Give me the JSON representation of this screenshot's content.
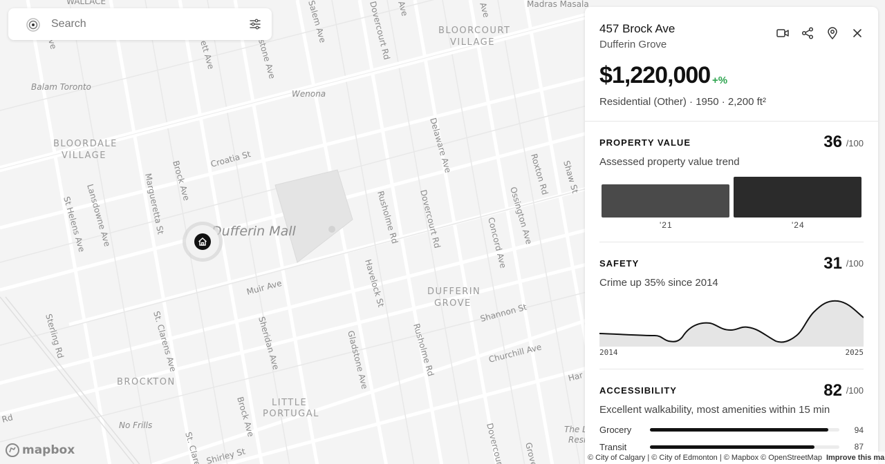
{
  "map": {
    "labels": {
      "wallace": "WALLACE",
      "madras": "Madras Masala",
      "balam": "Balam Toronto",
      "wenona": "Wenona",
      "bloorcourt1": "BLOORCOURT",
      "bloorcourt2": "VILLAGE",
      "bloordale1": "BLOORDALE",
      "bloordale2": "VILLAGE",
      "dufferin_mall": "Dufferin Mall",
      "dufferin_grove1": "DUFFERIN",
      "dufferin_grove2": "GROVE",
      "brockton": "BROCKTON",
      "little_portugal1": "LITTLE",
      "little_portugal2": "PORTUGAL",
      "no_frills": "No Frills",
      "croatia": "Croatia St",
      "brock": "Brock Ave",
      "brock2": "Brock Ave",
      "margueretta": "Margueretta St",
      "lansdowne": "Lansdowne Ave",
      "st_helens": "St Helens Ave",
      "muir": "Muir Ave",
      "st_clarens": "St. Clarens Ave",
      "st_clarens2": "St. Clare",
      "sheridan": "Sheridan Ave",
      "gladstone": "Gladstone Ave",
      "havelock": "Havelock St",
      "rusholme": "Rusholme Rd",
      "rusholme2": "Rusholme Rd",
      "dovercourt": "Dovercourt Rd",
      "dovercourt2": "Dovercourt Rd",
      "dovercourt3": "Dovercourt",
      "delaware": "Delaware Ave",
      "concord": "Concord Ave",
      "ossington": "Ossington Ave",
      "roxton": "Roxton Rd",
      "shaw": "Shaw St",
      "shannon": "Shannon St",
      "churchill": "Churchill Ave",
      "sterling": "Sterling Rd",
      "salem": "Salem Ave",
      "gladstone_top": "stone Ave",
      "ett": "ett Ave",
      "shirley": "Shirley St",
      "rd_left": "Rd",
      "the_res1": "The L",
      "the_res2": "Resi",
      "har": "Har",
      "grove": "Grove",
      "ave_top": "Ave",
      "ave_top2": "Ave",
      "ve_left": "ve"
    }
  },
  "search": {
    "placeholder": "Search",
    "logo_icon": "target-logo-icon",
    "filter_icon": "sliders-icon"
  },
  "property": {
    "address": "457 Brock Ave",
    "neighbourhood": "Dufferin Grove",
    "price": "$1,220,000",
    "change": "+%",
    "details": "Residential (Other) · 1950 · 2,200 ft²",
    "change_color": "#2ea44f",
    "actions": [
      "video-icon",
      "share-icon",
      "map-pin-icon",
      "close-icon"
    ]
  },
  "sections": {
    "value": {
      "title": "PROPERTY VALUE",
      "score": "36",
      "out_of": "/100",
      "subtitle": "Assessed property value trend",
      "bars": [
        {
          "label": "'21",
          "relative": 0.82,
          "color": "#4a4a4a"
        },
        {
          "label": "'24",
          "relative": 1.0,
          "color": "#2b2b2b"
        }
      ]
    },
    "safety": {
      "title": "SAFETY",
      "score": "31",
      "out_of": "/100",
      "subtitle": "Crime up 35% since 2014",
      "start_label": "2014",
      "end_label": "2025"
    },
    "accessibility": {
      "title": "ACCESSIBILITY",
      "score": "82",
      "out_of": "/100",
      "subtitle": "Excellent walkability, most amenities within 15 min",
      "rows": [
        {
          "label": "Grocery",
          "value": "94",
          "fraction": 0.94
        },
        {
          "label": "Transit",
          "value": "87",
          "fraction": 0.87
        }
      ]
    }
  },
  "footer": {
    "brand": "mapbox",
    "attribution": "© City of Calgary | © City of Edmonton | © Mapbox © OpenStreetMap",
    "improve": "Improve this map"
  }
}
